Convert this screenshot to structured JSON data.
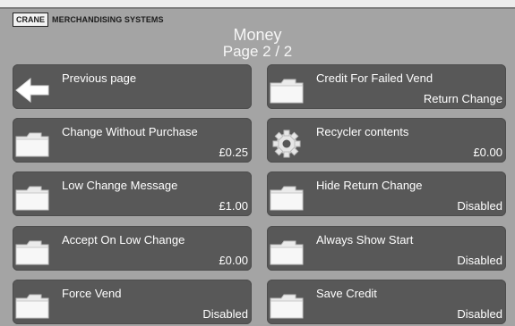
{
  "brand": {
    "logo": "CRANE",
    "name": "MERCHANDISING SYSTEMS"
  },
  "header": {
    "title": "Money",
    "page": "Page 2 / 2"
  },
  "tiles": [
    {
      "label": "Previous page",
      "value": "",
      "icon": "back-arrow-icon"
    },
    {
      "label": "Credit For Failed Vend",
      "value": "Return Change",
      "icon": "folder-icon"
    },
    {
      "label": "Change Without Purchase",
      "value": "£0.25",
      "icon": "folder-icon"
    },
    {
      "label": "Recycler contents",
      "value": "£0.00",
      "icon": "gear-icon"
    },
    {
      "label": "Low Change Message",
      "value": "£1.00",
      "icon": "folder-icon"
    },
    {
      "label": "Hide Return Change",
      "value": "Disabled",
      "icon": "folder-icon"
    },
    {
      "label": "Accept On Low Change",
      "value": "£0.00",
      "icon": "folder-icon"
    },
    {
      "label": "Always Show Start",
      "value": "Disabled",
      "icon": "folder-icon"
    },
    {
      "label": "Force Vend",
      "value": "Disabled",
      "icon": "folder-icon"
    },
    {
      "label": "Save Credit",
      "value": "Disabled",
      "icon": "folder-icon"
    }
  ],
  "colors": {
    "background": "#a4a4a4",
    "tile": "#585858",
    "text": "#ffffff"
  }
}
